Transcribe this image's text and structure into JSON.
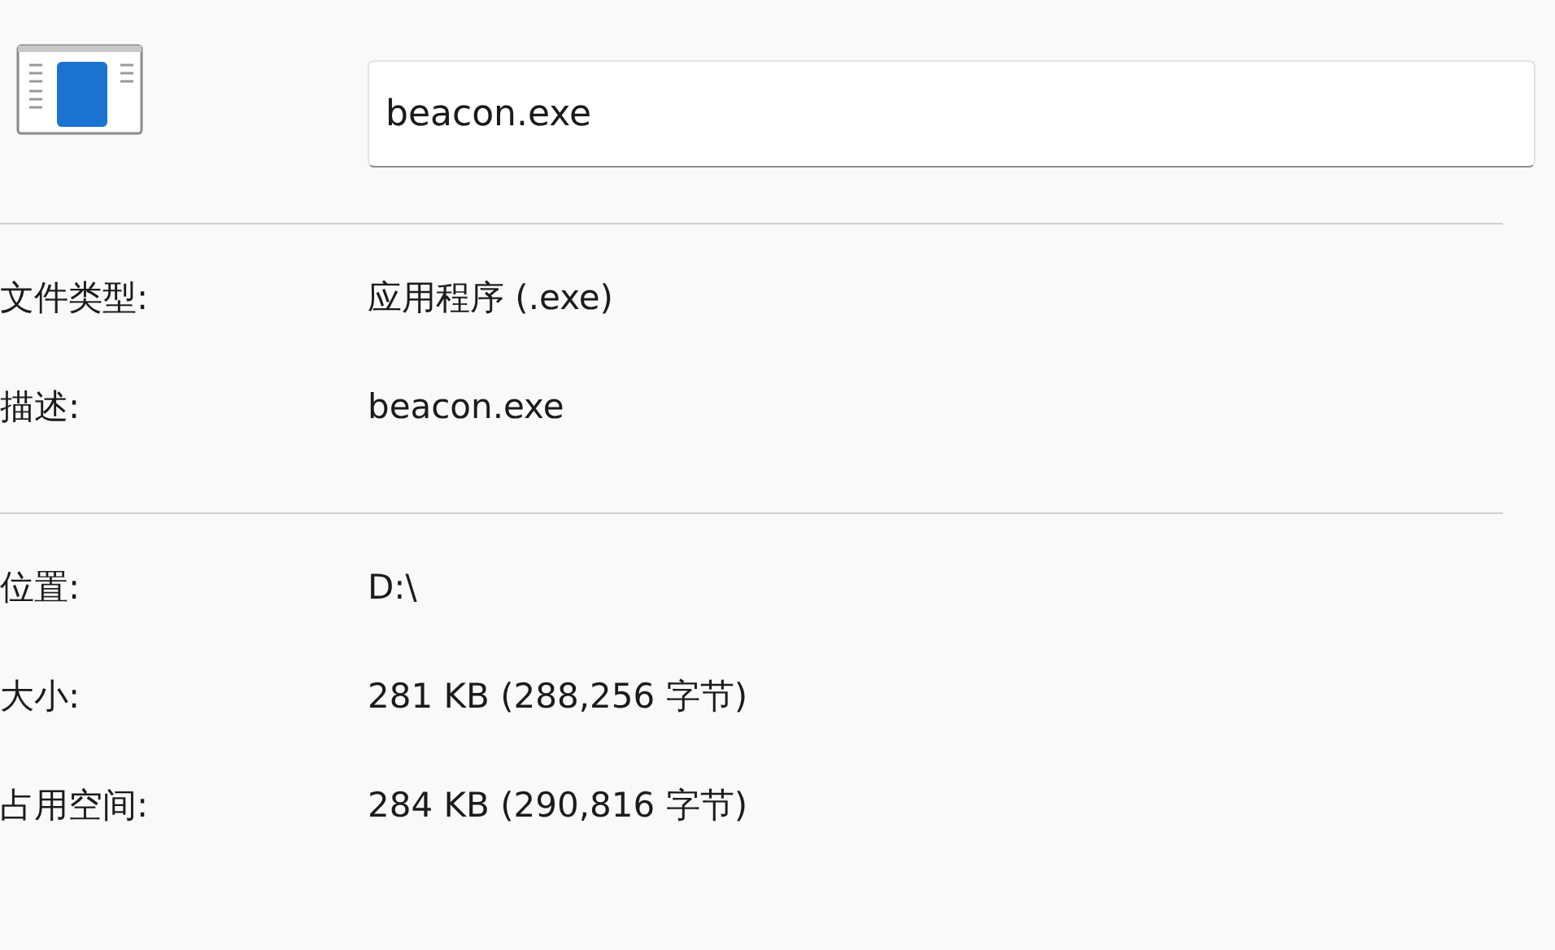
{
  "file_name": {
    "value": "beacon.exe"
  },
  "groups": [
    [
      {
        "label": "文件类型:",
        "value": "应用程序 (.exe)"
      },
      {
        "label": "描述:",
        "value": "beacon.exe"
      }
    ],
    [
      {
        "label": "位置:",
        "value": "D:\\"
      },
      {
        "label": "大小:",
        "value": "281 KB (288,256 字节)"
      },
      {
        "label": "占用空间:",
        "value": "284 KB (290,816 字节)"
      }
    ]
  ]
}
